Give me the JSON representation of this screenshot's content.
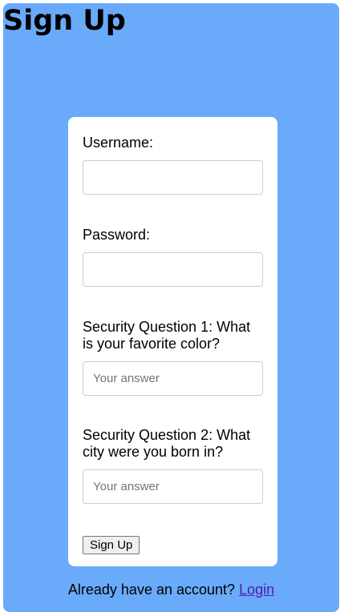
{
  "page": {
    "title": "Sign Up",
    "background_color": "#6aaafa"
  },
  "form": {
    "username_label": "Username:",
    "username_value": "",
    "password_label": "Password:",
    "password_value": "",
    "security_q1_label": "Security Question 1: What is your favorite color?",
    "security_q1_placeholder": "Your answer",
    "security_q2_label": "Security Question 2: What city were you born in?",
    "security_q2_placeholder": "Your answer",
    "submit_label": "Sign Up"
  },
  "footer": {
    "prompt": "Already have an account?",
    "login_link": "Login",
    "link_color": "#4b1fa8"
  }
}
